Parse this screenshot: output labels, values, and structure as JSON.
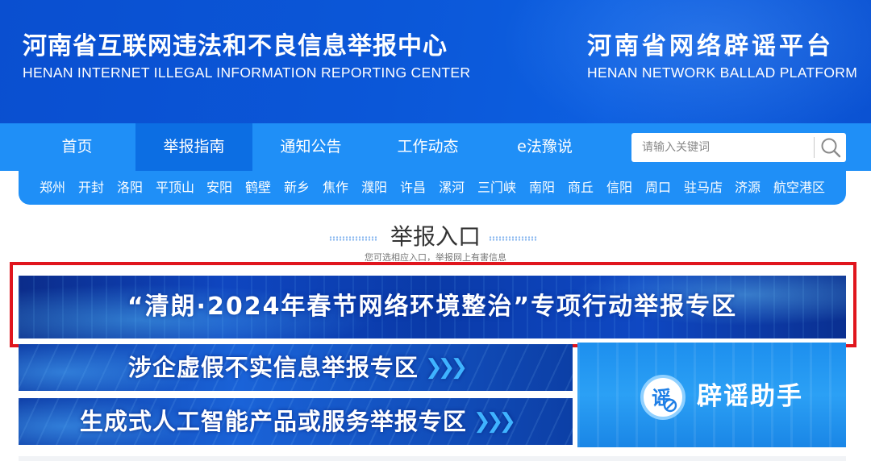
{
  "header": {
    "left_title_cn": "河南省互联网违法和不良信息举报中心",
    "left_title_en": "HENAN INTERNET ILLEGAL INFORMATION REPORTING CENTER",
    "right_title_cn": "河南省网络辟谣平台",
    "right_title_en": "HENAN NETWORK BALLAD PLATFORM"
  },
  "nav": {
    "items": [
      {
        "label": "首页",
        "active": false
      },
      {
        "label": "举报指南",
        "active": true
      },
      {
        "label": "通知公告",
        "active": false
      },
      {
        "label": "工作动态",
        "active": false
      },
      {
        "label": "e法豫说",
        "active": false
      }
    ],
    "search_placeholder": "请输入关键词"
  },
  "cities": [
    "郑州",
    "开封",
    "洛阳",
    "平顶山",
    "安阳",
    "鹤壁",
    "新乡",
    "焦作",
    "濮阳",
    "许昌",
    "漯河",
    "三门峡",
    "南阳",
    "商丘",
    "信阳",
    "周口",
    "驻马店",
    "济源",
    "航空港区"
  ],
  "section": {
    "title": "举报入口",
    "subtitle": "您可选相应入口，举报网上有害信息"
  },
  "banners": {
    "main": "“清朗·2024年春节网络环境整治”专项行动举报专区",
    "fake_info": "涉企虚假不实信息举报专区",
    "ai": "生成式人工智能产品或服务举报专区",
    "rumor": "辟谣助手",
    "rumor_icon_char": "谣"
  },
  "colors": {
    "header_blue": "#0b57d8",
    "nav_blue": "#1f8ff7",
    "nav_active": "#0c6ee3",
    "highlight_red": "#e0151d"
  }
}
